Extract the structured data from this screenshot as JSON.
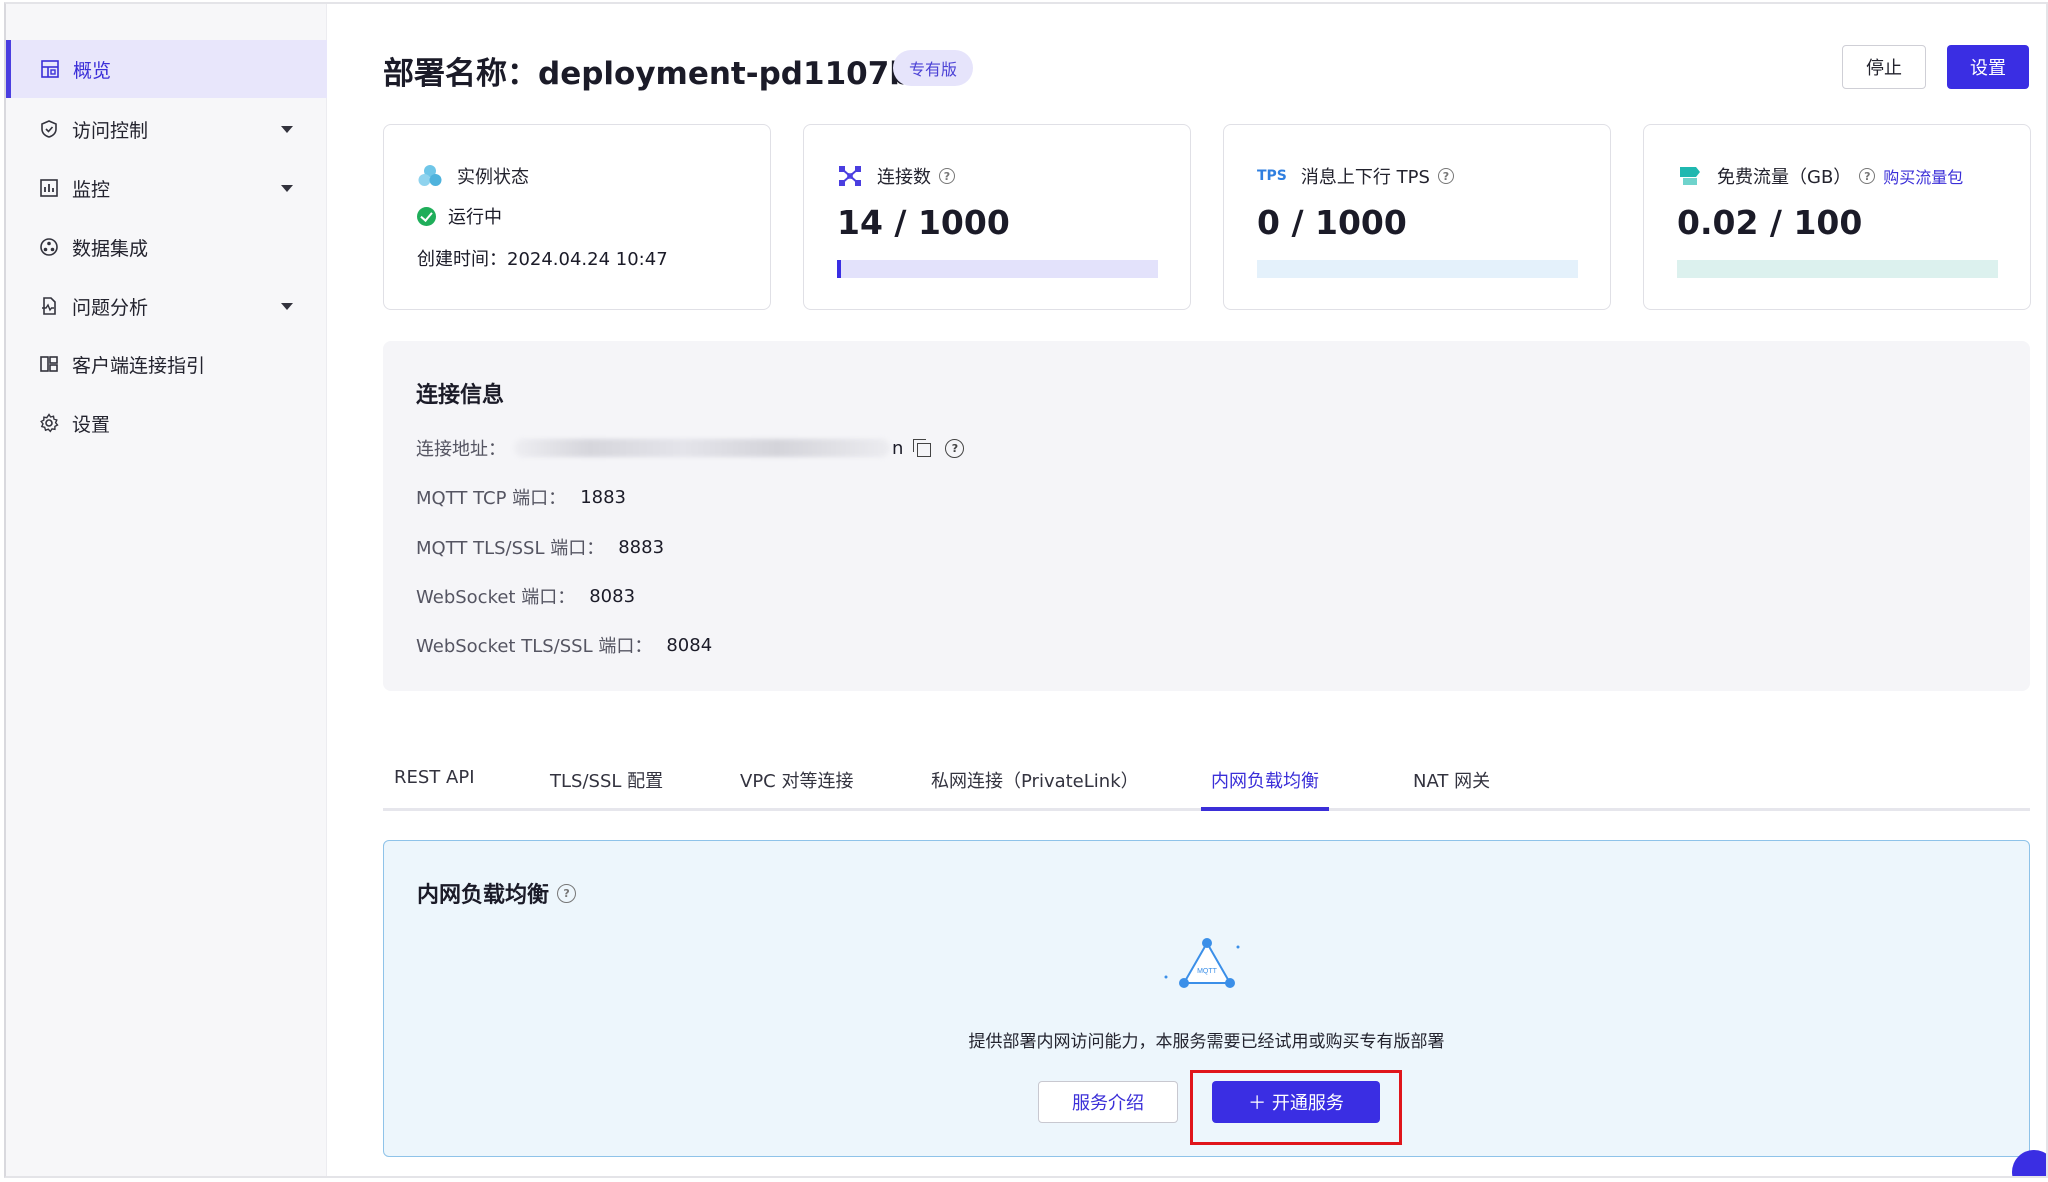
{
  "sidebar": {
    "items": [
      {
        "label": "概览",
        "icon": "overview-icon",
        "active": true
      },
      {
        "label": "访问控制",
        "icon": "shield-icon",
        "expandable": true
      },
      {
        "label": "监控",
        "icon": "monitor-chart-icon",
        "expandable": true
      },
      {
        "label": "数据集成",
        "icon": "integration-icon"
      },
      {
        "label": "问题分析",
        "icon": "diagnosis-icon",
        "expandable": true
      },
      {
        "label": "客户端连接指引",
        "icon": "client-guide-icon"
      },
      {
        "label": "设置",
        "icon": "gear-icon"
      }
    ]
  },
  "header": {
    "title": "部署名称：deployment-pd1107ba",
    "badge": "专有版",
    "stop_label": "停止",
    "settings_label": "设置"
  },
  "cards": {
    "status": {
      "label": "实例状态",
      "value": "运行中",
      "created": "创建时间：2024.04.24 10:47"
    },
    "connections": {
      "label": "连接数",
      "value": "14 / 1000",
      "fill": 0.014
    },
    "tps": {
      "badge": "TPS",
      "label": "消息上下行 TPS",
      "value": "0 / 1000",
      "fill": 0
    },
    "traffic": {
      "label": "免费流量（GB）",
      "link": "购买流量包",
      "value": "0.02 / 100",
      "fill": 0.0002
    }
  },
  "connection_info": {
    "title": "连接信息",
    "address_label": "连接地址：",
    "address_tail": "n",
    "rows": [
      {
        "label": "MQTT TCP 端口：",
        "value": "1883"
      },
      {
        "label": "MQTT TLS/SSL 端口：",
        "value": "8883"
      },
      {
        "label": "WebSocket 端口：",
        "value": "8083"
      },
      {
        "label": "WebSocket TLS/SSL 端口：",
        "value": "8084"
      }
    ]
  },
  "tabs": [
    {
      "label": "REST API"
    },
    {
      "label": "TLS/SSL 配置"
    },
    {
      "label": "VPC 对等连接"
    },
    {
      "label": "私网连接（PrivateLink）"
    },
    {
      "label": "内网负载均衡",
      "active": true
    },
    {
      "label": "NAT 网关"
    }
  ],
  "load_balancer": {
    "title": "内网负载均衡",
    "illustration_text": "MQTT",
    "description": "提供部署内网访问能力，本服务需要已经试用或购买专有版部署",
    "intro_label": "服务介绍",
    "enable_label": "＋ 开通服务"
  },
  "colors": {
    "accent": "#3a2ee3",
    "success": "#1fae5a",
    "highlight": "#e0151b"
  }
}
